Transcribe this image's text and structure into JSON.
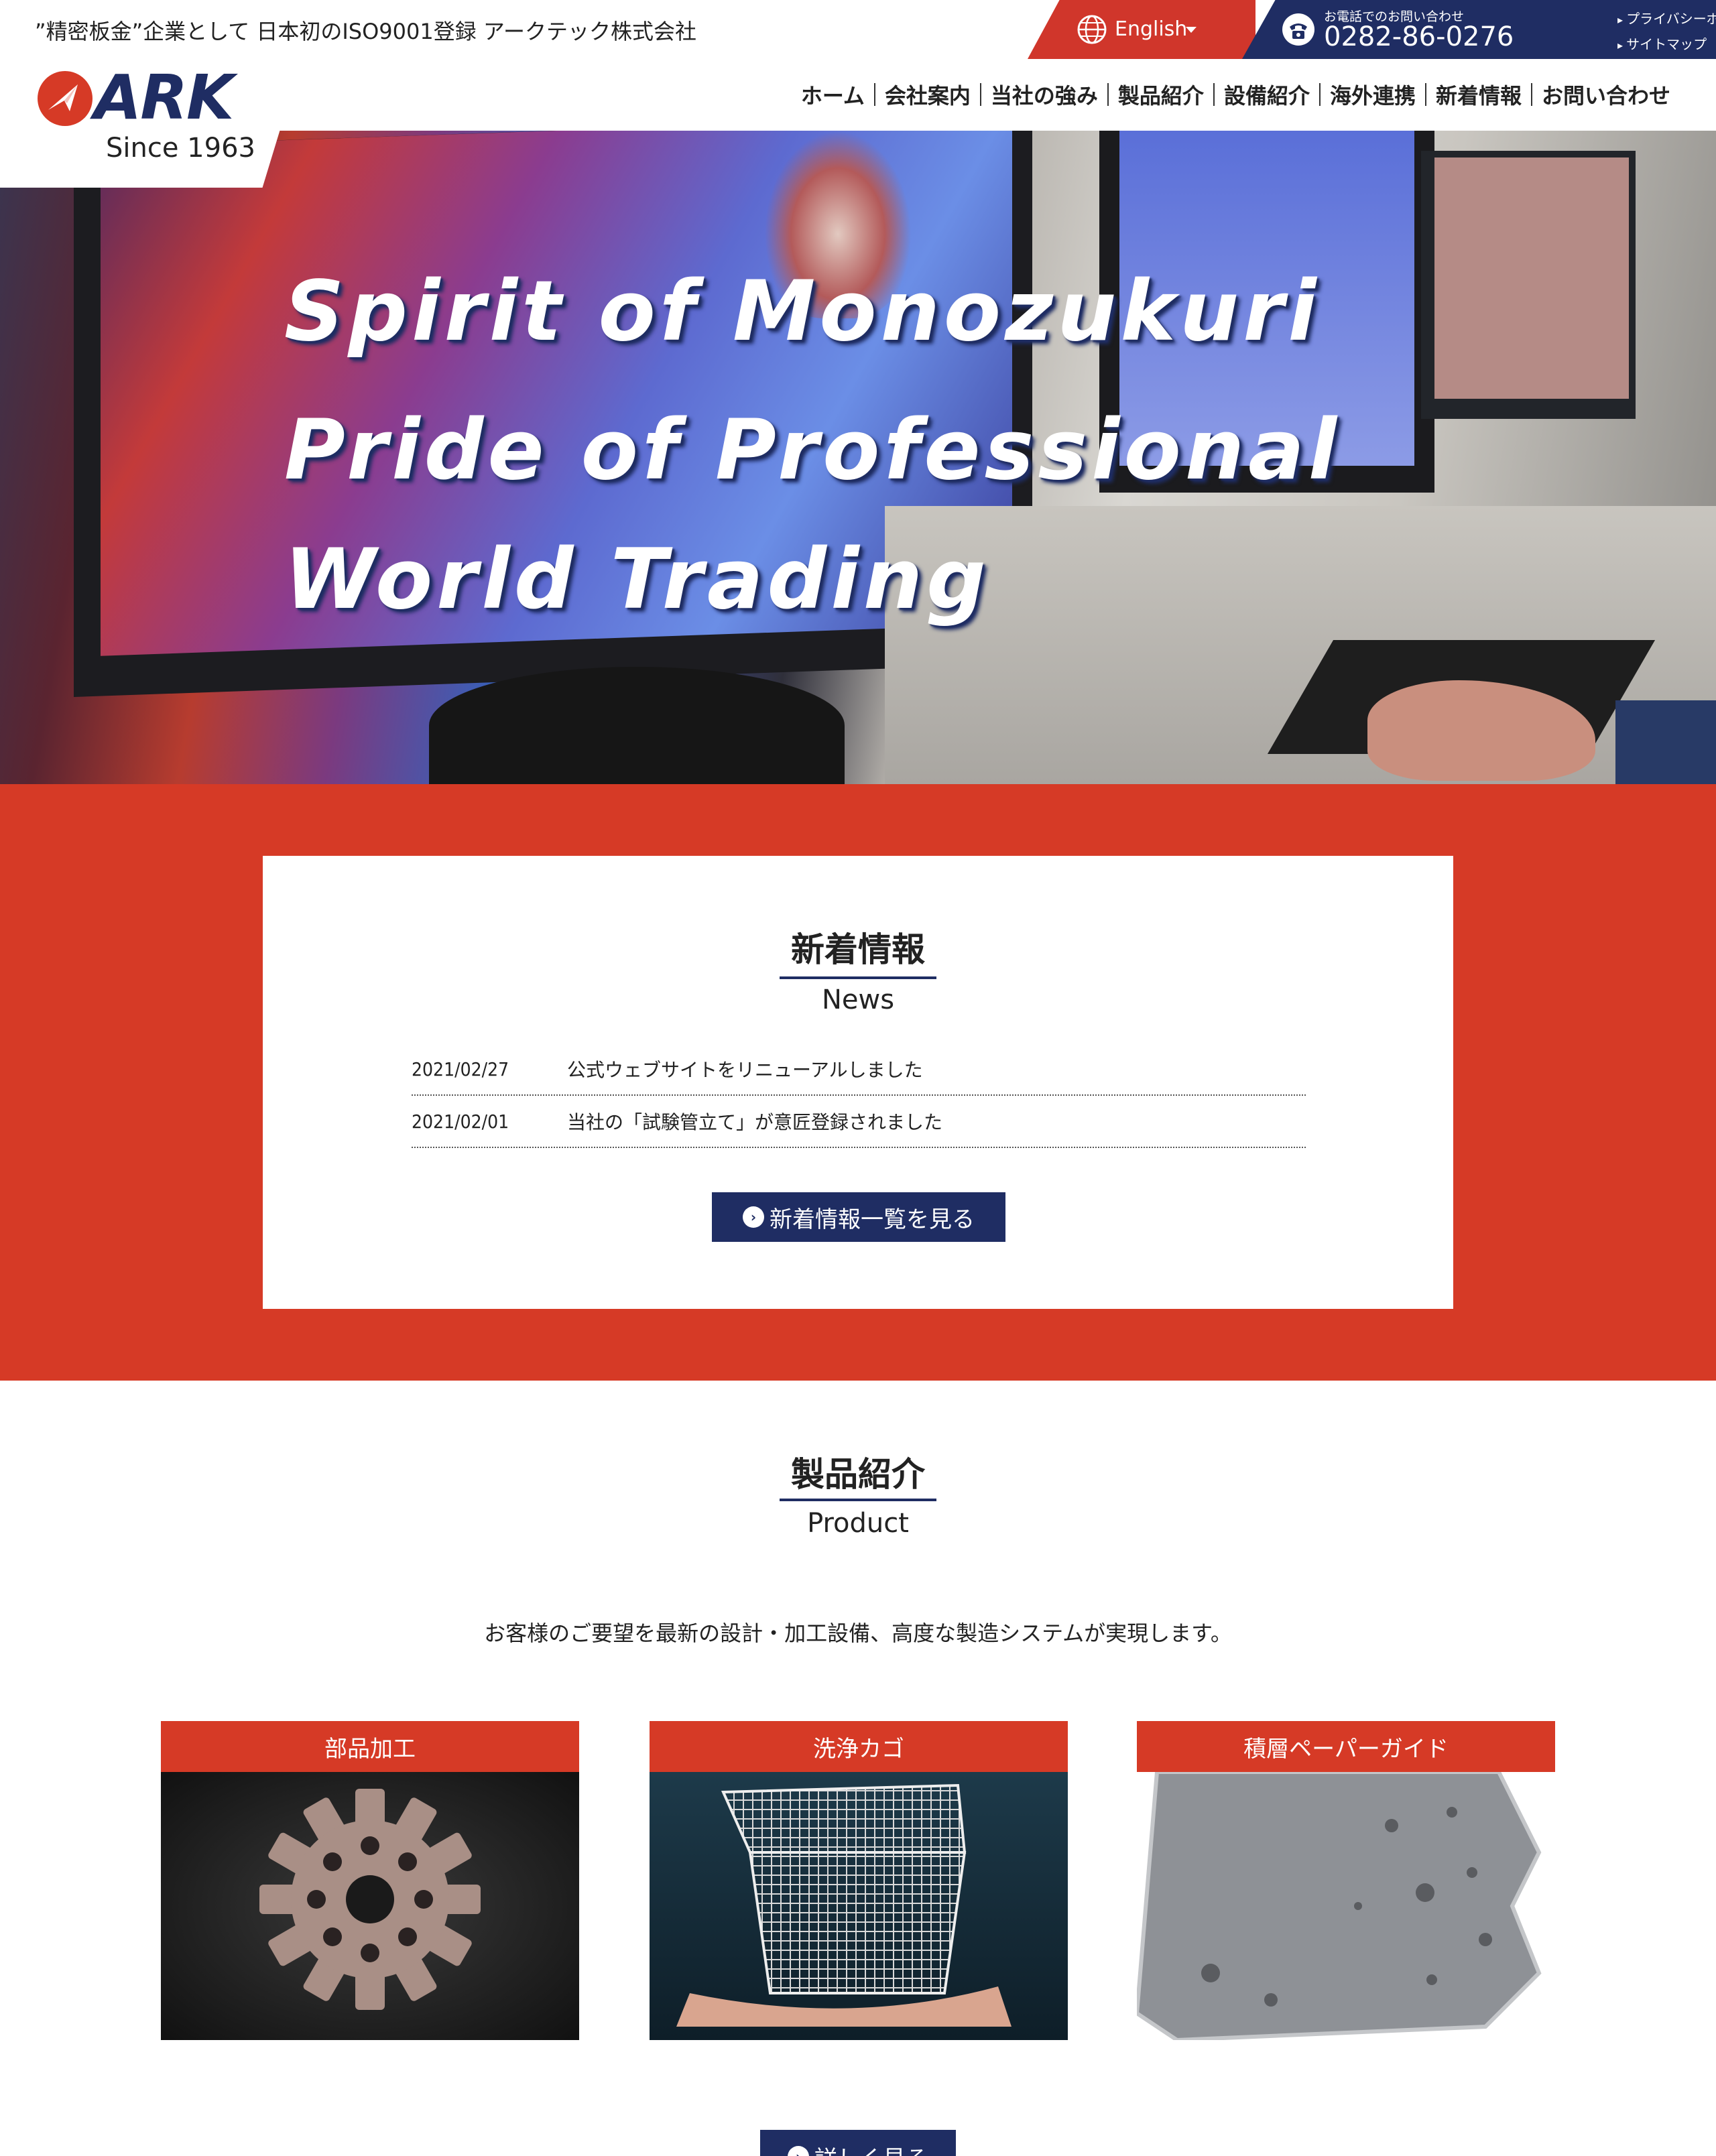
{
  "header": {
    "tagline": "”精密板金”企業として 日本初のISO9001登録 アークテック株式会社",
    "logo_text": "ARK",
    "since": "Since 1963",
    "language": "English",
    "phone_caption": "お電話でのお問い合わせ",
    "phone_number": "0282-86-0276",
    "util_links": [
      "プライバシーポリシー",
      "サイトマップ"
    ],
    "nav": [
      "ホーム",
      "会社案内",
      "当社の強み",
      "製品紹介",
      "設備紹介",
      "海外連携",
      "新着情報",
      "お問い合わせ"
    ],
    "colors": {
      "brand_red": "#d63a26",
      "brand_navy": "#1f2d63"
    }
  },
  "hero": {
    "lines": [
      "Spirit of Monozukuri",
      "Pride of Professional",
      "World Trading"
    ]
  },
  "news": {
    "title": "新着情報",
    "subtitle": "News",
    "items": [
      {
        "date": "2021/02/27",
        "text": "公式ウェブサイトをリニューアルしました"
      },
      {
        "date": "2021/02/01",
        "text": "当社の「試験管立て」が意匠登録されました"
      }
    ],
    "button_label": "新着情報一覧を見る"
  },
  "products": {
    "title": "製品紹介",
    "subtitle": "Product",
    "description": "お客様のご要望を最新の設計・加工設備、高度な製造システムが実現します。",
    "cards": [
      {
        "label": "部品加工"
      },
      {
        "label": "洗浄カゴ"
      },
      {
        "label": "積層ペーパーガイド"
      }
    ],
    "more_label": "詳しく見る"
  }
}
